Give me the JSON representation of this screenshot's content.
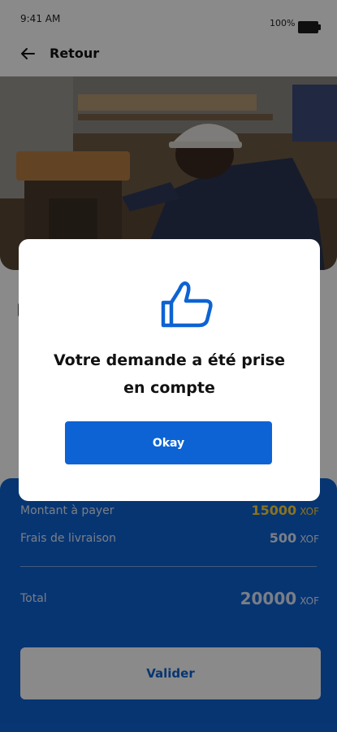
{
  "status_bar": {
    "time": "9:41 AM",
    "battery": "100%"
  },
  "nav": {
    "back_label": "Retour"
  },
  "summary": {
    "amount_label": "Montant à payer",
    "amount_value": "15000",
    "amount_unit": "XOF",
    "fees_label": "Frais de livraison",
    "fees_value": "500",
    "fees_unit": "XOF",
    "total_label": "Total",
    "total_value": "20000",
    "total_unit": "XOF",
    "submit_label": "Valider"
  },
  "modal": {
    "icon": "thumbs-up-icon",
    "message": "Votre demande a été prise en compte",
    "okay_label": "Okay"
  },
  "colors": {
    "primary": "#0d63d3",
    "accent": "#ffd23a"
  }
}
